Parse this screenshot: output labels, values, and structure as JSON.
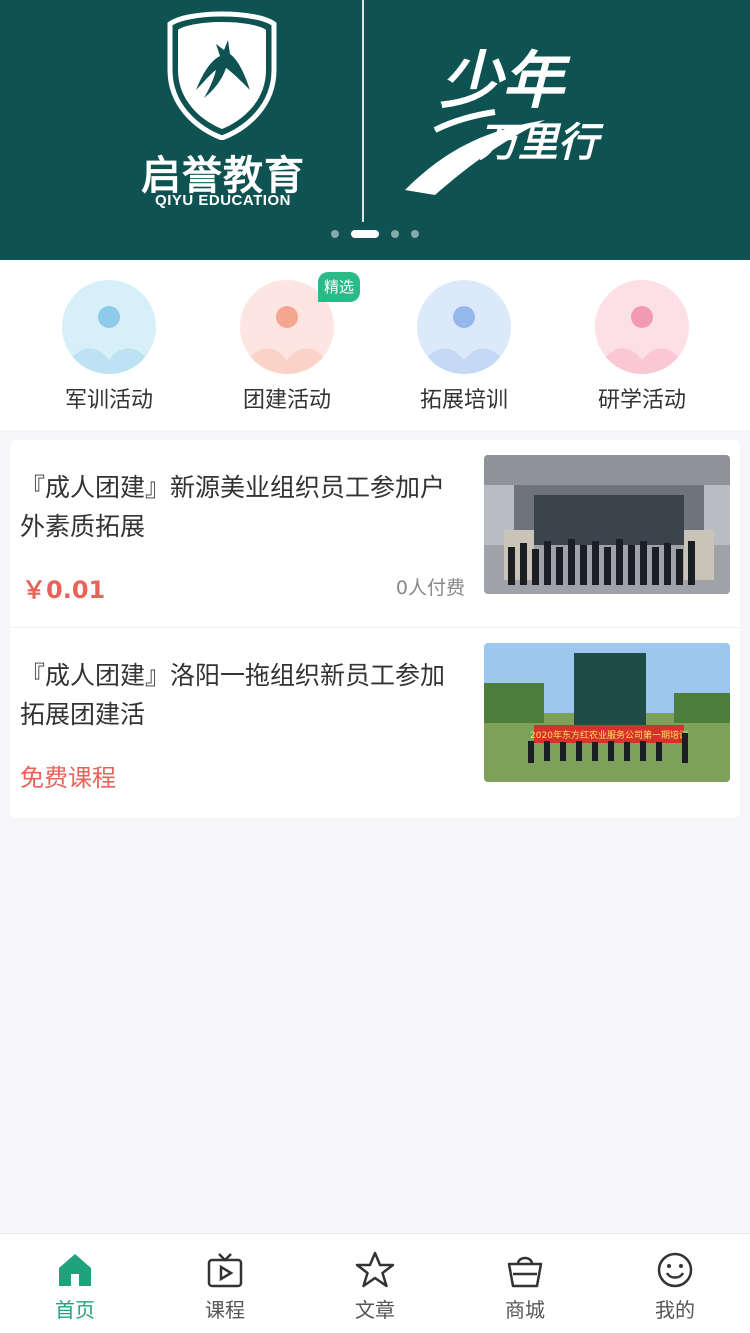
{
  "banner": {
    "brand_cn": "启誉教育",
    "brand_en": "QIYU EDUCATION",
    "slogan_line1": "少年",
    "slogan_line2": "万里行",
    "slide_count": 4,
    "active_slide": 2
  },
  "categories": [
    {
      "label": "军训活动",
      "color": "#c7e9f7",
      "accent": "#7ec3e6"
    },
    {
      "label": "团建活动",
      "color": "#fde1dc",
      "accent": "#f4a08f"
    },
    {
      "label": "拓展培训",
      "color": "#d6e6fb",
      "accent": "#8cb4ec"
    },
    {
      "label": "研学活动",
      "color": "#fcd8e0",
      "accent": "#f39aae"
    }
  ],
  "featured_badge": "精选",
  "courses": [
    {
      "title": "『成人团建』新源美业组织员工参加户外素质拓展",
      "price": "￥0.01",
      "paid_count": "0人付费"
    },
    {
      "title": "『成人团建』洛阳一拖组织新员工参加拓展团建活",
      "price_label": "免费课程",
      "banner_text": "2020年东方红农业服务公司第一期培训"
    }
  ],
  "tabbar": [
    {
      "label": "首页",
      "icon": "home-icon",
      "active": true
    },
    {
      "label": "课程",
      "icon": "tv-play-icon",
      "active": false
    },
    {
      "label": "文章",
      "icon": "star-icon",
      "active": false
    },
    {
      "label": "商城",
      "icon": "shopping-basket-icon",
      "active": false
    },
    {
      "label": "我的",
      "icon": "smiley-face-icon",
      "active": false
    }
  ],
  "colors": {
    "brand_dark": "#0f5252",
    "accent_green": "#1fa37d",
    "price_red": "#e8625a"
  }
}
